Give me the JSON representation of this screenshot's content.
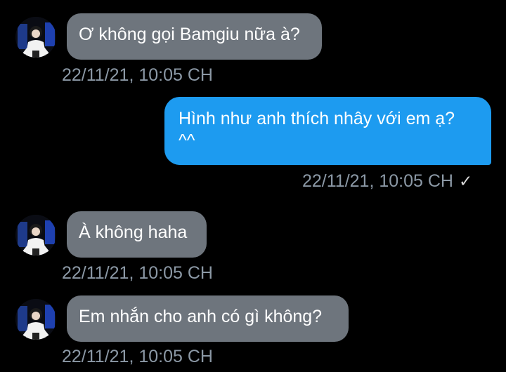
{
  "conversation": {
    "messages": [
      {
        "direction": "received",
        "text": "Ơ không gọi Bamgiu nữa à?",
        "timestamp": "22/11/21, 10:05 CH"
      },
      {
        "direction": "sent",
        "text": "Hình như anh thích nhây với em ạ? ^^",
        "timestamp": "22/11/21, 10:05 CH",
        "status_icon": "checkmark-icon",
        "status_glyph": "✓"
      },
      {
        "direction": "received",
        "text": "À không haha",
        "timestamp": "22/11/21, 10:05 CH"
      },
      {
        "direction": "received",
        "text": "Em nhắn cho anh có gì không?",
        "timestamp": "22/11/21, 10:05 CH"
      }
    ]
  },
  "colors": {
    "background": "#000000",
    "received_bubble": "#6e757d",
    "sent_bubble": "#1d9bf0",
    "timestamp": "#8b98a5"
  }
}
